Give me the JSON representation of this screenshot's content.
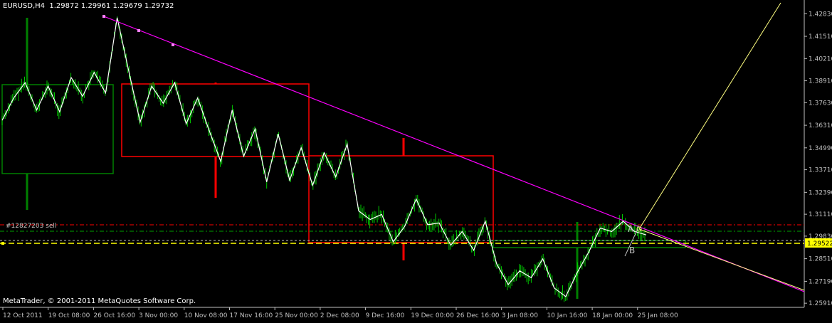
{
  "header": {
    "symbol": "EURUSD,H4",
    "ohlc": "1.29872 1.29961 1.29679 1.29732"
  },
  "footer": {
    "copyright": "MetaTrader, © 2001-2011 MetaQuotes Software Corp."
  },
  "order_label": "#12827203 sell",
  "colors": {
    "background": "#000000",
    "candles": "#00c800",
    "zigzag": "#ffffff",
    "trendline": "#ff00ff",
    "projection": "#ffff80",
    "boxes": "#ff0000",
    "left_box": "#008000",
    "current_price": "#ffff00",
    "axis": "#c0c0c0"
  },
  "chart_data": {
    "type": "line",
    "instrument": "EURUSD",
    "timeframe": "H4",
    "ylim": [
      1.2575,
      1.4305
    ],
    "y_ticks": [
      "1.42830",
      "1.41510",
      "1.40210",
      "1.38910",
      "1.37630",
      "1.36310",
      "1.34990",
      "1.33710",
      "1.32390",
      "1.31110",
      "1.29830",
      "1.28510",
      "1.27190",
      "1.25910"
    ],
    "x_ticks": [
      "12 Oct 2011",
      "19 Oct 08:00",
      "26 Oct 16:00",
      "3 Nov 00:00",
      "10 Nov 08:00",
      "17 Nov 16:00",
      "25 Nov 00:00",
      "2 Dec 08:00",
      "9 Dec 16:00",
      "19 Dec 00:00",
      "26 Dec 16:00",
      "3 Jan 08:00",
      "10 Jan 16:00",
      "18 Jan 00:00",
      "25 Jan 08:00"
    ],
    "current_price": "1.29522",
    "series": [
      {
        "values": [
          1.366,
          1.379,
          1.388,
          1.372,
          1.386,
          1.371,
          1.391,
          1.38,
          1.394,
          1.382,
          1.426,
          1.395,
          1.365,
          1.386,
          1.376,
          1.388,
          1.364,
          1.379,
          1.36,
          1.342,
          1.372,
          1.345,
          1.361,
          1.33,
          1.358,
          1.331,
          1.35,
          1.328,
          1.347,
          1.333,
          1.352,
          1.313,
          1.308,
          1.311,
          1.295,
          1.304,
          1.32,
          1.305,
          1.306,
          1.293,
          1.301,
          1.29,
          1.307,
          1.282,
          1.27,
          1.278,
          1.274,
          1.285,
          1.268,
          1.263,
          1.277,
          1.289,
          1.303,
          1.301,
          1.307,
          1.301,
          1.299
        ]
      }
    ],
    "annotations": [
      "A",
      "B"
    ]
  }
}
